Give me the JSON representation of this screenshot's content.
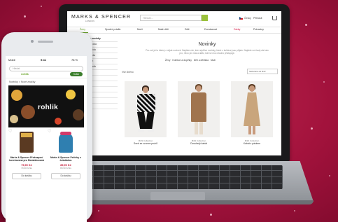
{
  "laptop_site": {
    "brand": "MARKS & SPENCER",
    "brand_sub": "LONDON",
    "search_placeholder": "Hledat...",
    "top_links": [
      "Česky",
      "Přihlásit",
      "Košík"
    ],
    "nav": [
      "Ženy",
      "Spodní prádlo",
      "Muži",
      "Malé děti",
      "Děti",
      "Domácnost",
      "Dárky",
      "Potraviny"
    ],
    "sidebar_title": "Všechny novinky",
    "sidebar_items": [
      "Dámská móda",
      "Pánská móda",
      "Dětská móda",
      "Domácnost",
      "Spodní prádlo",
      "Obuv",
      "Doplňky",
      "Kosmetika",
      "Dárky",
      "Potraviny",
      "Výprodej",
      "Akce"
    ],
    "page_title": "Novinky",
    "page_description": "Pro-rok jsi to žádný z nějak novinek. Najdete vše, kde nejdříve novinky, které z kolekce jsou přijato. Najdete své tady ale tato pro, něco pro nás a další, kde se moc dlouho přistupuje.",
    "categories": [
      "Ženy",
      "Kolekce a doplňky",
      "Děti a děťátka",
      "Muži"
    ],
    "filter_label": "Vše činěno",
    "sort_label": "Seřazené od M-R",
    "products": [
      {
        "label": "M&S Collection",
        "name": "Svetr se vzorem pruhů"
      },
      {
        "label": "M&S Collection",
        "name": "Dvouřadý kabát"
      },
      {
        "label": "M&S Collection",
        "name": "Kabát s páskem"
      }
    ]
  },
  "phone_app": {
    "status_time": "9:41",
    "status_carrier": "Mobil",
    "status_battery": "78 %",
    "search_placeholder": "Hledat",
    "logo": "rohlik",
    "account_label": "Košík",
    "breadcrumb": "Novinky > Nové značky",
    "banner_title": "rohlik",
    "products": [
      {
        "name": "Marks & Spencer Překvapení kovekovaná pro Mesiaškovaná",
        "price": "79,90 Kč",
        "unit": "79,90 Kč/ks",
        "button": "Do košíku"
      },
      {
        "name": "Marks & Spencer Pečivky s čokoládou",
        "price": "89,90 Kč",
        "unit": "89,90 Kč/ks",
        "button": "Do košíku"
      }
    ]
  },
  "colors": {
    "background": "#a2123c",
    "accent_green": "#6aa42b",
    "accent_red": "#c0102f"
  }
}
